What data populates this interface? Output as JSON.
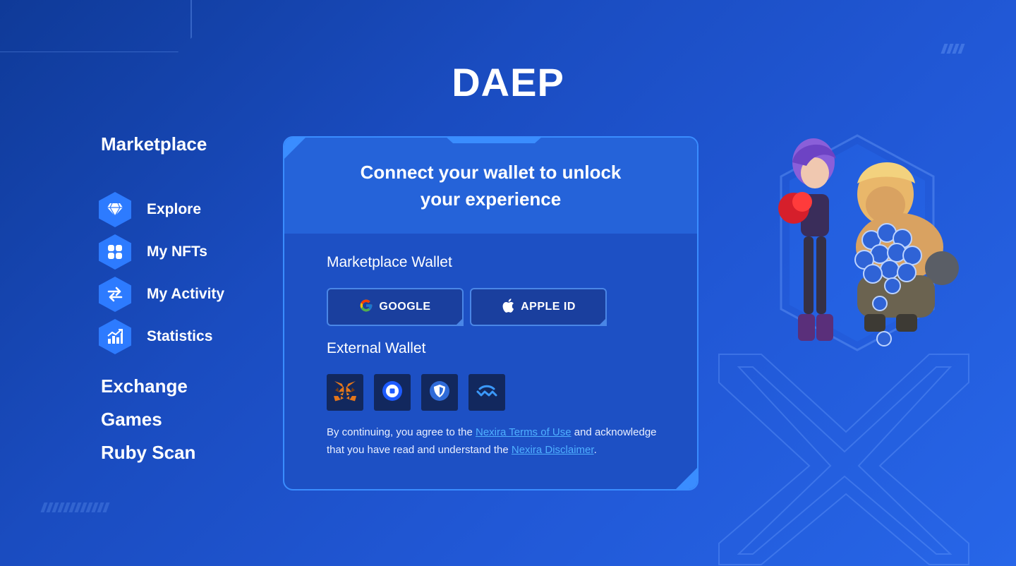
{
  "brand": {
    "logo": "DAEP"
  },
  "sidebar": {
    "marketplace_title": "Marketplace",
    "items": [
      {
        "label": "Explore",
        "icon": "diamond-icon"
      },
      {
        "label": "My NFTs",
        "icon": "grid-icon"
      },
      {
        "label": "My Activity",
        "icon": "swap-arrows-icon"
      },
      {
        "label": "Statistics",
        "icon": "chart-up-icon"
      }
    ],
    "sections": [
      "Exchange",
      "Games",
      "Ruby Scan"
    ]
  },
  "card": {
    "title_line1": "Connect your wallet to unlock",
    "title_line2": "your experience",
    "marketplace_wallet_label": "Marketplace Wallet",
    "google_label": "GOOGLE",
    "apple_label": "APPLE ID",
    "external_wallet_label": "External Wallet",
    "external_wallets": [
      "metamask-icon",
      "coinbase-icon",
      "trust-wallet-icon",
      "walletconnect-icon"
    ],
    "legal": {
      "prefix": "By continuing, you agree to the ",
      "terms_link": "Nexira Terms of Use",
      "middle": " and acknowledge that you have read and understand the ",
      "disclaimer_link": "Nexira Disclaimer",
      "suffix": "."
    }
  },
  "colors": {
    "accent": "#3a8dff",
    "link": "#4fb0ff",
    "icon_bg": "#2d7bff"
  }
}
